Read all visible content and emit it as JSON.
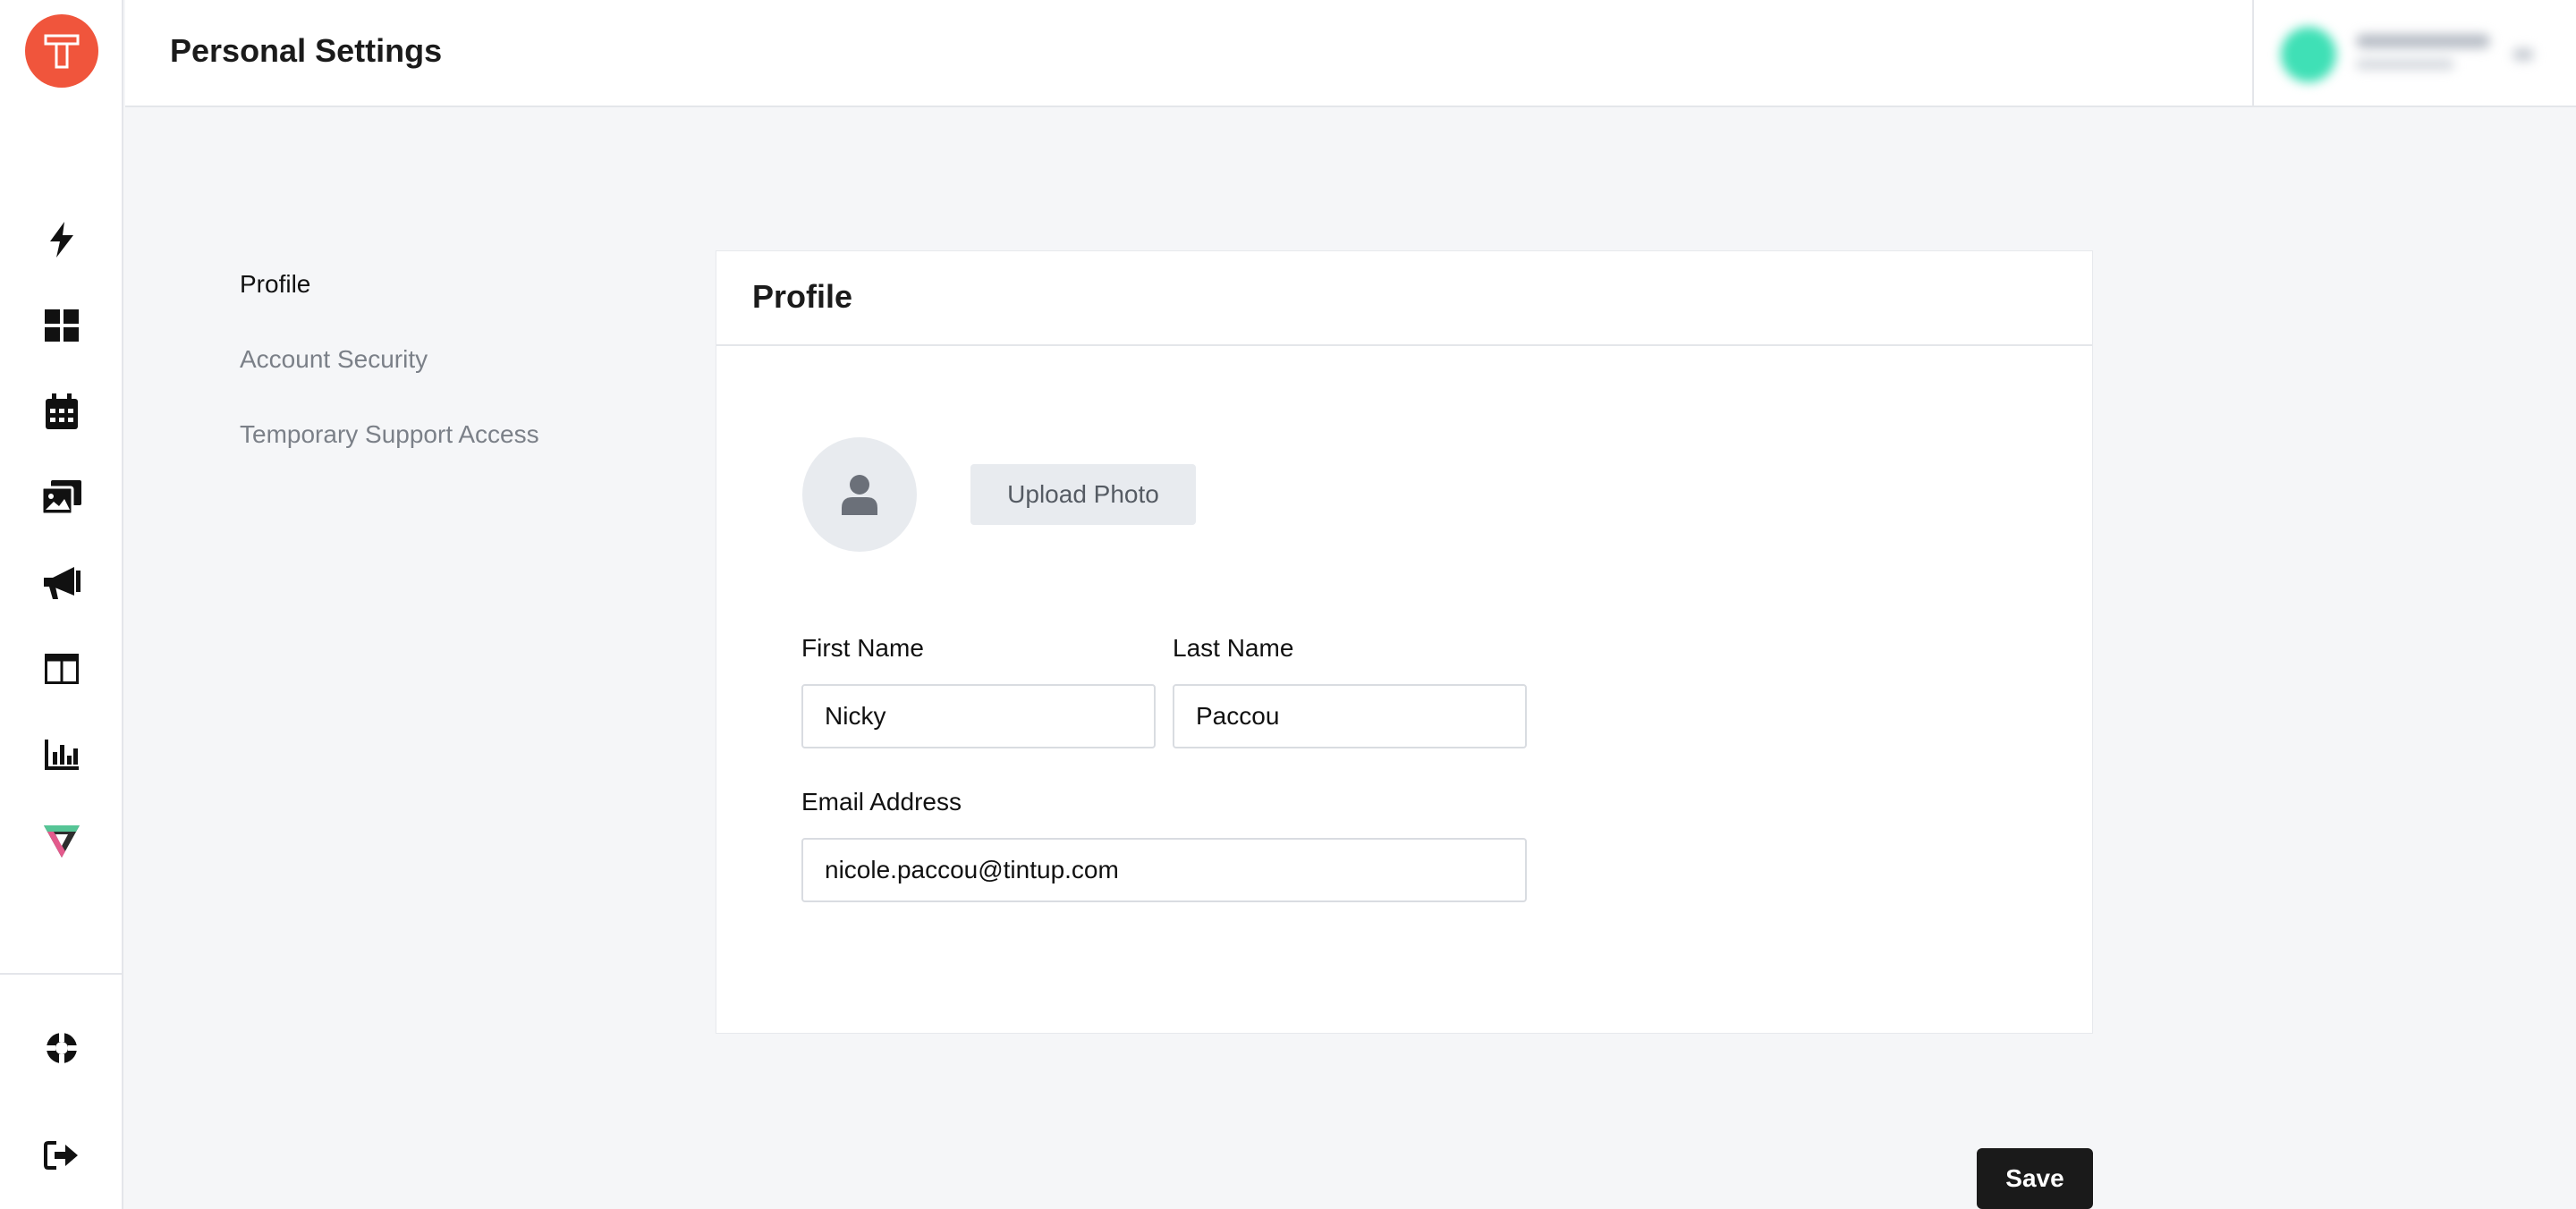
{
  "app": {
    "title": "Personal Settings",
    "accent_color": "#f0553c",
    "brand_letter": "T"
  },
  "rail": {
    "icons": [
      "lightning-icon",
      "dashboard-icon",
      "calendar-icon",
      "gallery-icon",
      "megaphone-icon",
      "layout-icon",
      "analytics-icon",
      "vibe-logo-icon"
    ],
    "bottom_icons": [
      "support-icon",
      "logout-icon"
    ]
  },
  "settings_nav": {
    "items": [
      {
        "label": "Profile",
        "active": true
      },
      {
        "label": "Account Security",
        "active": false
      },
      {
        "label": "Temporary Support Access",
        "active": false
      }
    ]
  },
  "profile": {
    "title": "Profile",
    "upload_label": "Upload Photo",
    "first_name_label": "First Name",
    "first_name_value": "Nicky",
    "last_name_label": "Last Name",
    "last_name_value": "Paccou",
    "email_label": "Email Address",
    "email_value": "nicole.paccou@tintup.com"
  },
  "actions": {
    "save_label": "Save"
  }
}
